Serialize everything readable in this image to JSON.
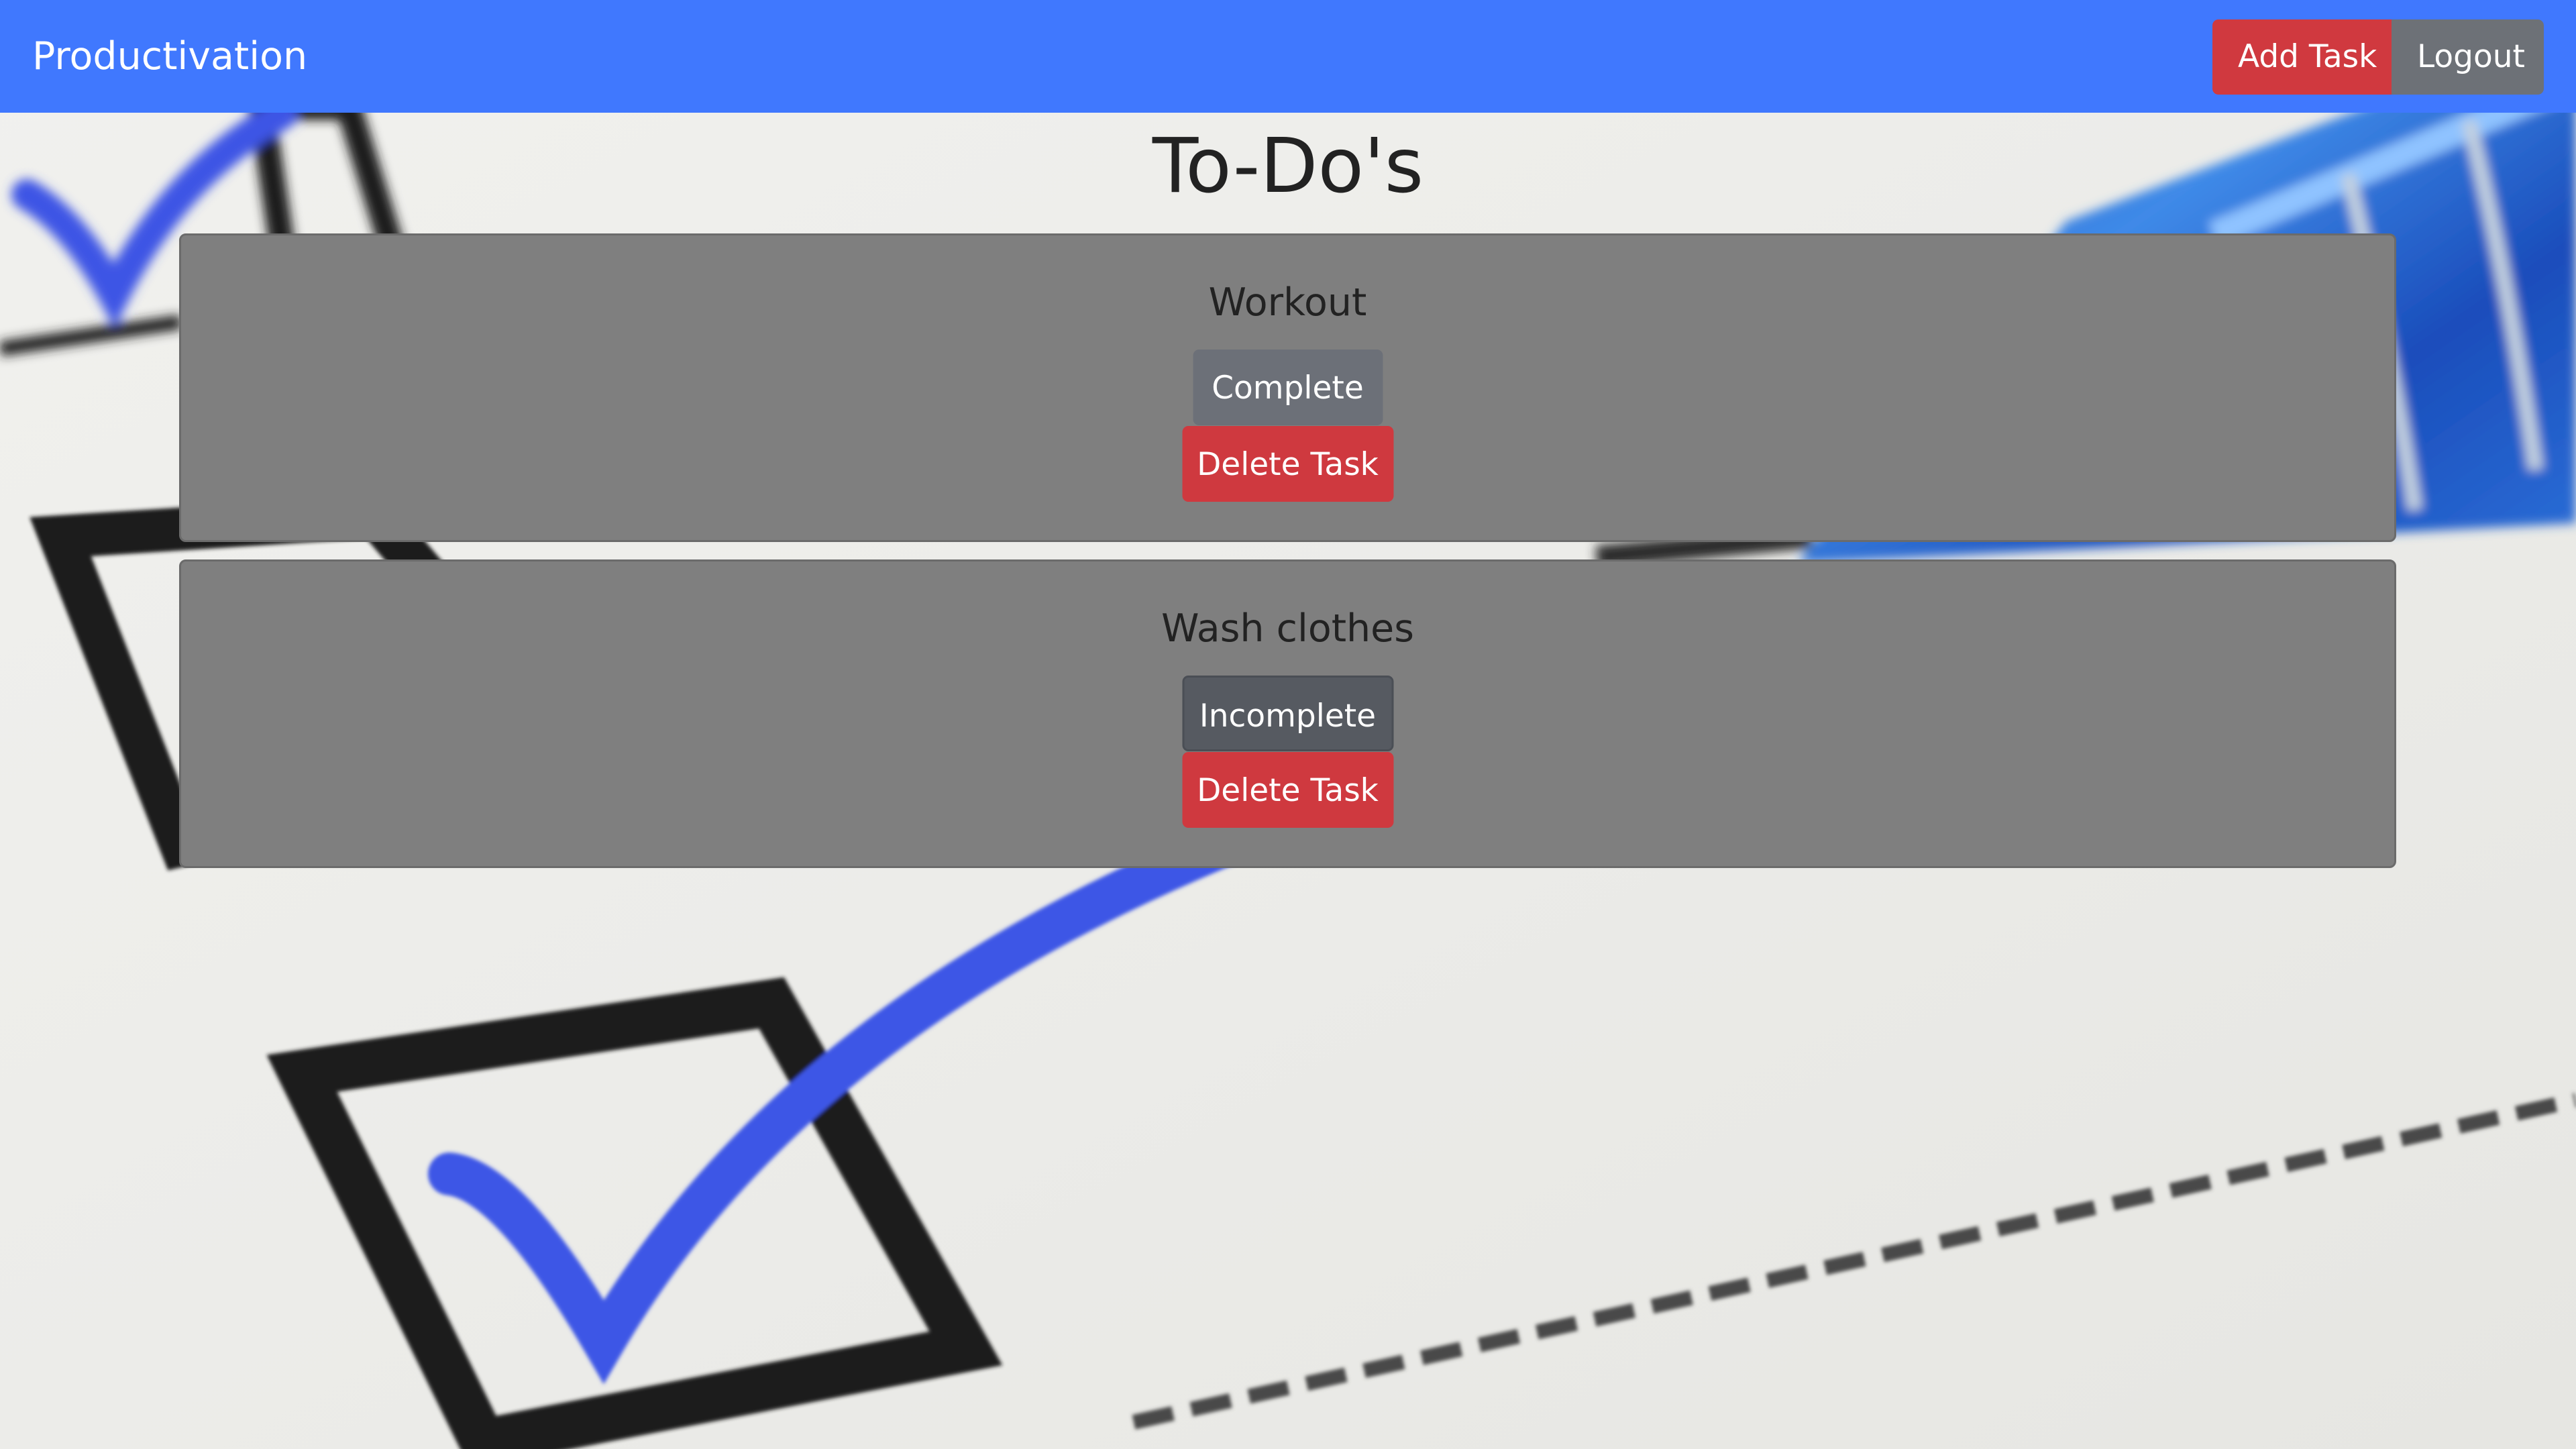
{
  "navbar": {
    "brand": "Productivation",
    "add_task_label": "Add Task",
    "logout_label": "Logout",
    "background_color": "#4078fe"
  },
  "page": {
    "title": "To-Do's"
  },
  "tasks": [
    {
      "title": "Workout",
      "status_label": "Complete",
      "delete_label": "Delete Task"
    },
    {
      "title": "Wash clothes",
      "status_label": "Incomplete",
      "delete_label": "Delete Task"
    }
  ],
  "colors": {
    "danger": "#cf393f",
    "secondary": "#6c7078",
    "secondary_dark": "#565a61",
    "card": "#7f7f7f",
    "checkmark_blue": "#3b55e6"
  },
  "background": {
    "icon": "checklist-checkbox-photo"
  }
}
